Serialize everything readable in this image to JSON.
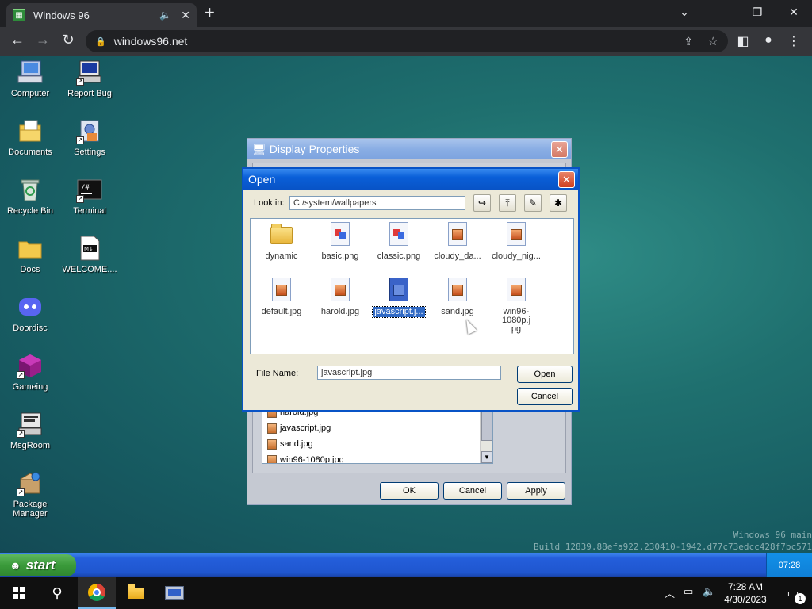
{
  "browser": {
    "tab_title": "Windows 96",
    "tab_favicon": "windows96-icon",
    "url": "windows96.net"
  },
  "desktop": {
    "icons": [
      {
        "label": "Computer",
        "icon": "computer-icon"
      },
      {
        "label": "Report Bug",
        "icon": "report-bug-icon"
      },
      {
        "label": "Documents",
        "icon": "documents-icon"
      },
      {
        "label": "Settings",
        "icon": "settings-icon"
      },
      {
        "label": "Recycle Bin",
        "icon": "recycle-bin-icon"
      },
      {
        "label": "Terminal",
        "icon": "terminal-icon"
      },
      {
        "label": "Docs",
        "icon": "folder-icon"
      },
      {
        "label": "WELCOME....",
        "icon": "markdown-icon"
      },
      {
        "label": "Doordisc",
        "icon": "doordisc-icon"
      },
      {
        "label": "Gameing",
        "icon": "gameing-icon"
      },
      {
        "label": "MsgRoom",
        "icon": "msgroom-icon"
      },
      {
        "label": "Package Manager",
        "icon": "package-manager-icon"
      }
    ],
    "watermark_line1": "Windows 96 main",
    "watermark_line2": "Build 12839.88efa922.230410-1942.d77c73edcc428f7bc571"
  },
  "display_properties": {
    "title": "Display Properties",
    "list_items": [
      "harold.jpg",
      "javascript.jpg",
      "sand.jpg",
      "win96-1080p.jpg"
    ],
    "ok_label": "OK",
    "cancel_label": "Cancel",
    "apply_label": "Apply"
  },
  "open_dialog": {
    "title": "Open",
    "look_in_label": "Look in:",
    "look_in_value": "C:/system/wallpapers",
    "files": [
      {
        "label": "dynamic",
        "kind": "folder"
      },
      {
        "label": "basic.png",
        "kind": "png"
      },
      {
        "label": "classic.png",
        "kind": "png"
      },
      {
        "label": "cloudy_da...",
        "kind": "jpg"
      },
      {
        "label": "cloudy_nig...",
        "kind": "jpg"
      },
      {
        "label": "default.jpg",
        "kind": "jpg"
      },
      {
        "label": "harold.jpg",
        "kind": "jpg"
      },
      {
        "label": "javascript.j...",
        "kind": "js",
        "selected": true
      },
      {
        "label": "sand.jpg",
        "kind": "jpg"
      },
      {
        "label": "win96-1080p.jpg",
        "kind": "jpg"
      }
    ],
    "file_name_label": "File Name:",
    "file_name_value": "javascript.jpg",
    "open_label": "Open",
    "cancel_label": "Cancel"
  },
  "xp_taskbar": {
    "start_label": "start",
    "clock": "07:28"
  },
  "win10_taskbar": {
    "time": "7:28 AM",
    "date": "4/30/2023",
    "notification_count": "1"
  },
  "colors": {
    "xp_title_blue": "#0853c6",
    "selection_blue": "#316ac5",
    "desktop_teal": "#1f706f",
    "start_green": "#3a9a3a"
  }
}
